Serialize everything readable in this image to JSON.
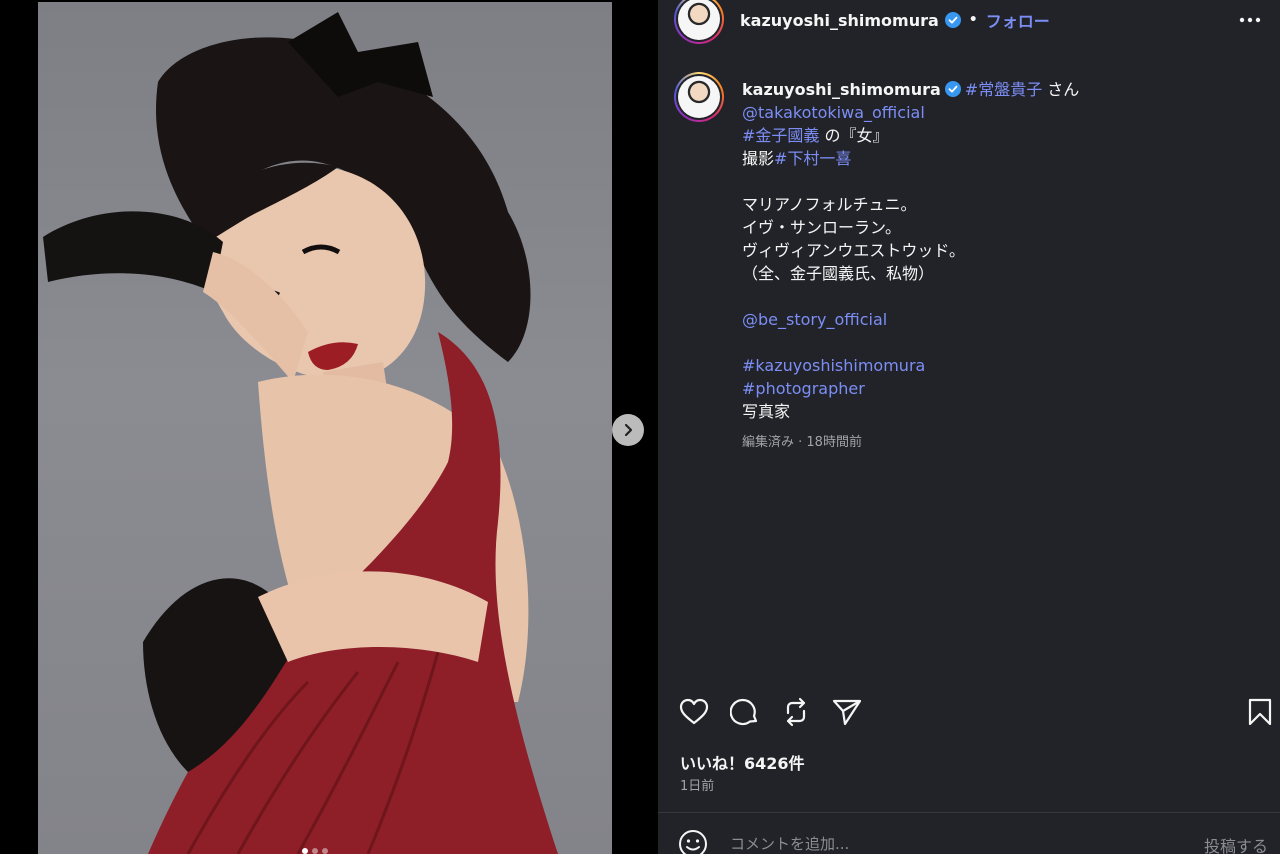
{
  "header": {
    "username": "kazuyoshi_shimomura",
    "separator": "•",
    "follow_label": "フォロー"
  },
  "caption": {
    "username": "kazuyoshi_shimomura",
    "line1_tag": "#常盤貴子",
    "line1_text": "さん",
    "mention1": "@takakotokiwa_official",
    "line3_tag": "#金子國義",
    "line3_text": "の『女』",
    "line4_text": "撮影",
    "line4_tag": "#下村一喜",
    "line6": "マリアノフォルチュニ。",
    "line7": "イヴ・サンローラン。",
    "line8": "ヴィヴィアンウエストウッド。",
    "line9": "（全、金子國義氏、私物）",
    "mention2": "@be_story_official",
    "tag_a": "#kazuyoshishimomura",
    "tag_b": "#photographer",
    "last_line": "写真家",
    "meta": "編集済み · 18時間前"
  },
  "actions": {
    "like_icon": "heart-icon",
    "comment_icon": "comment-icon",
    "repost_icon": "repost-icon",
    "share_icon": "send-icon",
    "save_icon": "bookmark-icon"
  },
  "likes_text": "いいね！6426件",
  "time_ago": "1日前",
  "comment": {
    "placeholder": "コメントを追加...",
    "post_label": "投稿する"
  },
  "carousel": {
    "total": 3,
    "active": 1
  },
  "colors": {
    "link": "#7c8ef5",
    "panel": "#212328",
    "verified": "#3897f0"
  }
}
